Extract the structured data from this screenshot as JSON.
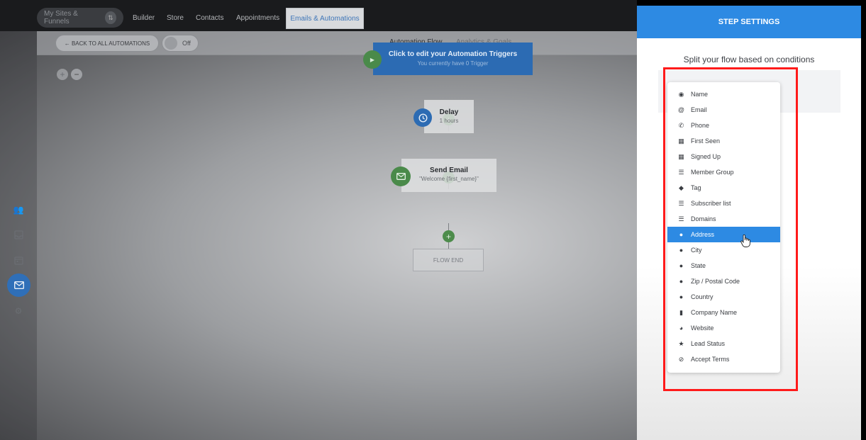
{
  "topnav": {
    "sites_label": "My Sites & Funnels",
    "links": [
      "Builder",
      "Store",
      "Contacts",
      "Appointments"
    ],
    "active_label": "Emails & Automations"
  },
  "subbar": {
    "back_label": "← BACK TO ALL AUTOMATIONS",
    "toggle_label": "Off",
    "tabs": [
      "Automation Flow",
      "Analytics & Goals"
    ]
  },
  "zoom": {
    "in": "+",
    "out": "−"
  },
  "flow": {
    "trigger_title": "Click to edit your Automation Triggers",
    "trigger_sub": "You currently have 0 Trigger",
    "delay_title": "Delay",
    "delay_sub": "1 hours",
    "email_title": "Send Email",
    "email_sub": "\"Welcome {first_name}\"",
    "flow_end": "FLOW END"
  },
  "panel": {
    "header": "STEP SETTINGS",
    "subtitle": "Split your flow based on conditions"
  },
  "dropdown": {
    "selected_index": 9,
    "items": [
      {
        "label": "Name",
        "icon": "user-circle-icon"
      },
      {
        "label": "Email",
        "icon": "at-icon"
      },
      {
        "label": "Phone",
        "icon": "phone-icon"
      },
      {
        "label": "First Seen",
        "icon": "calendar-icon"
      },
      {
        "label": "Signed Up",
        "icon": "calendar-icon"
      },
      {
        "label": "Member Group",
        "icon": "list-icon"
      },
      {
        "label": "Tag",
        "icon": "tag-icon"
      },
      {
        "label": "Subscriber list",
        "icon": "list-icon"
      },
      {
        "label": "Domains",
        "icon": "list-icon"
      },
      {
        "label": "Address",
        "icon": "map-pin-icon"
      },
      {
        "label": "City",
        "icon": "map-pin-icon"
      },
      {
        "label": "State",
        "icon": "map-pin-icon"
      },
      {
        "label": "Zip / Postal Code",
        "icon": "map-pin-icon"
      },
      {
        "label": "Country",
        "icon": "map-pin-icon"
      },
      {
        "label": "Company Name",
        "icon": "building-icon"
      },
      {
        "label": "Website",
        "icon": "globe-icon"
      },
      {
        "label": "Lead Status",
        "icon": "star-icon"
      },
      {
        "label": "Accept Terms",
        "icon": "check-circle-icon"
      }
    ]
  },
  "colors": {
    "accent_blue": "#2d8ae3",
    "trigger_blue": "#2c6bb3",
    "node_green": "#4a8a4a",
    "highlight_red": "#ff1a1a"
  }
}
